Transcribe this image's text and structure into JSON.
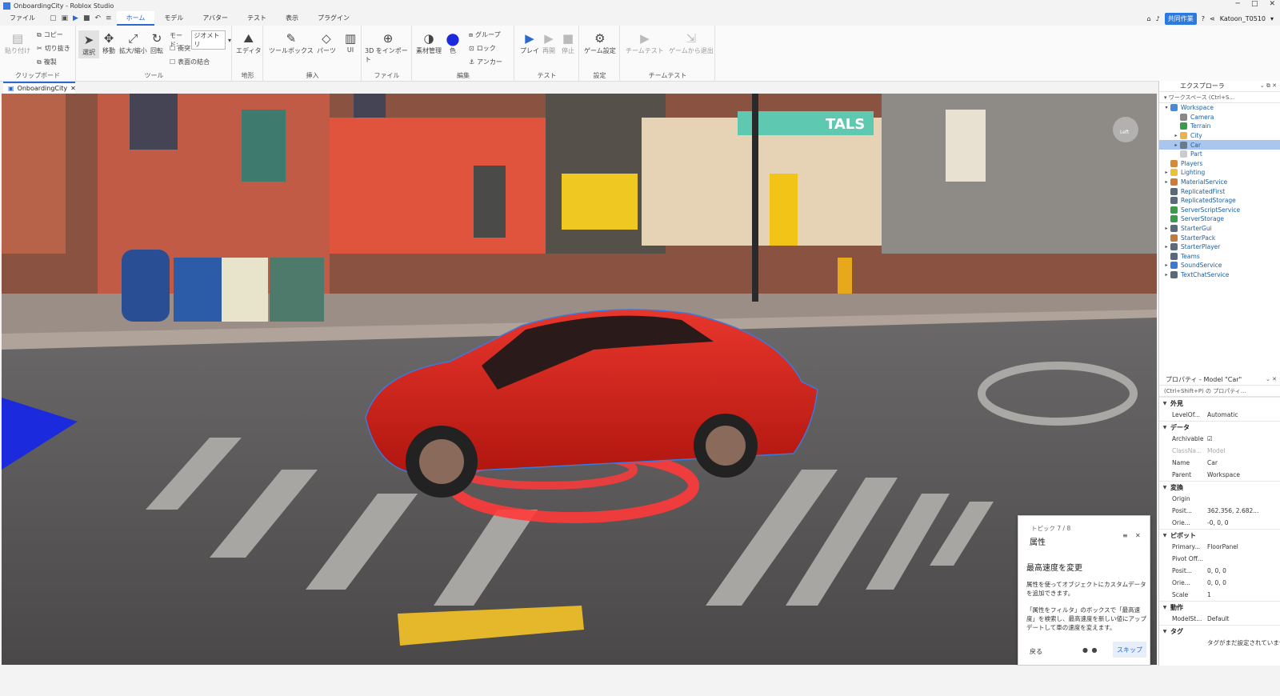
{
  "window": {
    "title": "OnboardingCity - Roblox Studio"
  },
  "menu": {
    "items": [
      "ファイル",
      "ホーム",
      "モデル",
      "アバター",
      "テスト",
      "表示",
      "プラグイン"
    ],
    "active_index": 1,
    "collab_label": "共同作業",
    "username": "Katoon_T0510"
  },
  "ribbon": {
    "clipboard": {
      "label": "クリップボード",
      "paste": "貼り付け",
      "copy": "コピー",
      "cut": "切り抜き",
      "duplicate": "複製"
    },
    "tools": {
      "label": "ツール",
      "select": "選択",
      "move": "移動",
      "scale": "拡大/縮小",
      "rotate": "回転",
      "mode_label": "モード:",
      "mode_value": "ジオメトリ",
      "collision": "衝突",
      "join": "表面の結合"
    },
    "terrain": {
      "label": "地形",
      "editor": "エディタ"
    },
    "insert": {
      "label": "挿入",
      "toolbox": "ツールボックス",
      "part": "パーツ",
      "ui": "UI"
    },
    "file": {
      "label": "ファイル",
      "import3d": "3D をインポート"
    },
    "edit": {
      "label": "編集",
      "material": "素材管理",
      "color": "色",
      "group": "グループ",
      "lock": "ロック",
      "anchor": "アンカー"
    },
    "test": {
      "label": "テスト",
      "play": "プレイ",
      "resume": "再開",
      "stop": "停止"
    },
    "settings": {
      "label": "設定",
      "game_settings": "ゲーム設定"
    },
    "team_test": {
      "label": "チームテスト",
      "team_test": "チームテスト",
      "exit_game": "ゲームから退出"
    }
  },
  "tabs": {
    "doc": "OnboardingCity"
  },
  "explorer": {
    "title": "エクスプローラ",
    "filter": "ワークスペース (Ctrl+S...",
    "items": [
      {
        "label": "Workspace",
        "indent": 0,
        "arrow": "▾",
        "color": "#4a8ad0"
      },
      {
        "label": "Camera",
        "indent": 1,
        "arrow": "",
        "color": "#888888"
      },
      {
        "label": "Terrain",
        "indent": 1,
        "arrow": "",
        "color": "#3b9a4c"
      },
      {
        "label": "City",
        "indent": 1,
        "arrow": "▸",
        "color": "#e8b34a"
      },
      {
        "label": "Car",
        "indent": 1,
        "arrow": "▸",
        "color": "#6a7a8a"
      },
      {
        "label": "Part",
        "indent": 1,
        "arrow": "",
        "color": "#cccccc"
      },
      {
        "label": "Players",
        "indent": 0,
        "arrow": "",
        "color": "#d48a3a"
      },
      {
        "label": "Lighting",
        "indent": 0,
        "arrow": "▸",
        "color": "#e8c23a"
      },
      {
        "label": "MaterialService",
        "indent": 0,
        "arrow": "▸",
        "color": "#d07a3a"
      },
      {
        "label": "ReplicatedFirst",
        "indent": 0,
        "arrow": "",
        "color": "#5a6a7a"
      },
      {
        "label": "ReplicatedStorage",
        "indent": 0,
        "arrow": "",
        "color": "#5a6a7a"
      },
      {
        "label": "ServerScriptService",
        "indent": 0,
        "arrow": "",
        "color": "#3b9a4c"
      },
      {
        "label": "ServerStorage",
        "indent": 0,
        "arrow": "",
        "color": "#3b9a4c"
      },
      {
        "label": "StarterGui",
        "indent": 0,
        "arrow": "▸",
        "color": "#5a6a7a"
      },
      {
        "label": "StarterPack",
        "indent": 0,
        "arrow": "",
        "color": "#c07a3a"
      },
      {
        "label": "StarterPlayer",
        "indent": 0,
        "arrow": "▸",
        "color": "#5a6a7a"
      },
      {
        "label": "Teams",
        "indent": 0,
        "arrow": "",
        "color": "#5a6a7a"
      },
      {
        "label": "SoundService",
        "indent": 0,
        "arrow": "▸",
        "color": "#3b7ad0"
      },
      {
        "label": "TextChatService",
        "indent": 0,
        "arrow": "▸",
        "color": "#5a6a7a"
      }
    ],
    "selected_index": 4
  },
  "properties": {
    "title": "プロパティ - Model \"Car\"",
    "filter": "(Ctrl+Shift+P) の プロパティ...",
    "sections": [
      {
        "name": "外見",
        "rows": [
          {
            "n": "LevelOf...",
            "v": "Automatic"
          }
        ]
      },
      {
        "name": "データ",
        "rows": [
          {
            "n": "Archivable",
            "v": "☑"
          },
          {
            "n": "ClassNa...",
            "v": "Model",
            "dim": true
          },
          {
            "n": "Name",
            "v": "Car"
          },
          {
            "n": "Parent",
            "v": "Workspace"
          }
        ]
      },
      {
        "name": "変換",
        "rows": [
          {
            "n": "Origin",
            "v": ""
          },
          {
            "n": "Posit...",
            "v": "362.356, 2.682..."
          },
          {
            "n": "Orie...",
            "v": "-0, 0, 0"
          }
        ]
      },
      {
        "name": "ピボット",
        "rows": [
          {
            "n": "Primary...",
            "v": "FloorPanel"
          },
          {
            "n": "Pivot Off...",
            "v": ""
          },
          {
            "n": "Posit...",
            "v": "0, 0, 0"
          },
          {
            "n": "Orie...",
            "v": "0, 0, 0"
          },
          {
            "n": "Scale",
            "v": "1"
          }
        ]
      },
      {
        "name": "動作",
        "rows": [
          {
            "n": "ModelSt...",
            "v": "Default"
          }
        ]
      },
      {
        "name": "タグ",
        "rows": [
          {
            "n": "",
            "v": "タグがまだ設定されていませ"
          }
        ]
      }
    ]
  },
  "tour": {
    "step": "トピック 7 / 8",
    "title": "属性",
    "subtitle": "最高速度を変更",
    "body1": "属性を使ってオブジェクトにカスタムデータを追加できます。",
    "body2": "「属性をフィルタ」のボックスで「最高速度」を検索し、最高速度を新しい値にアップデートして車の速度を変えます。",
    "back": "戻る",
    "dots": "● ●",
    "skip": "スキップ"
  },
  "scene": {
    "sign_text": "TALS",
    "gizmo_text": "Left"
  },
  "colors": {
    "accent": "#2a6ad0",
    "car": "#d8221c",
    "selection": "#a8c6ee"
  }
}
